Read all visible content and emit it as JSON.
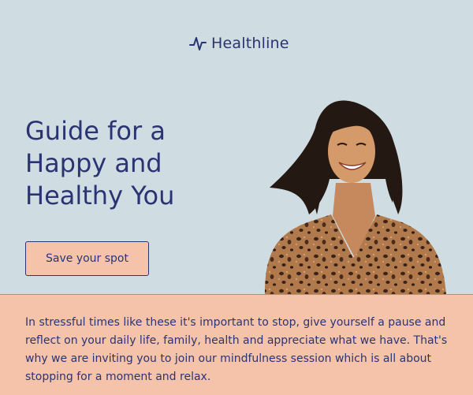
{
  "brand": {
    "name": "Healthline",
    "icon": "pulse-icon"
  },
  "headline": {
    "line1": "Guide for a",
    "line2": "Happy and",
    "line3": "Healthy You"
  },
  "cta": {
    "label": "Save your spot"
  },
  "body": {
    "text": "In stressful times like these it's important to stop, give yourself a pause and reflect on your daily life, family, health and appreciate what we have. That's why we are inviting you to join our mindfulness session which is all about stopping for a moment and relax."
  },
  "colors": {
    "sky": "#cfdde2",
    "peach": "#f5c3a9",
    "navy": "#2b3473"
  }
}
